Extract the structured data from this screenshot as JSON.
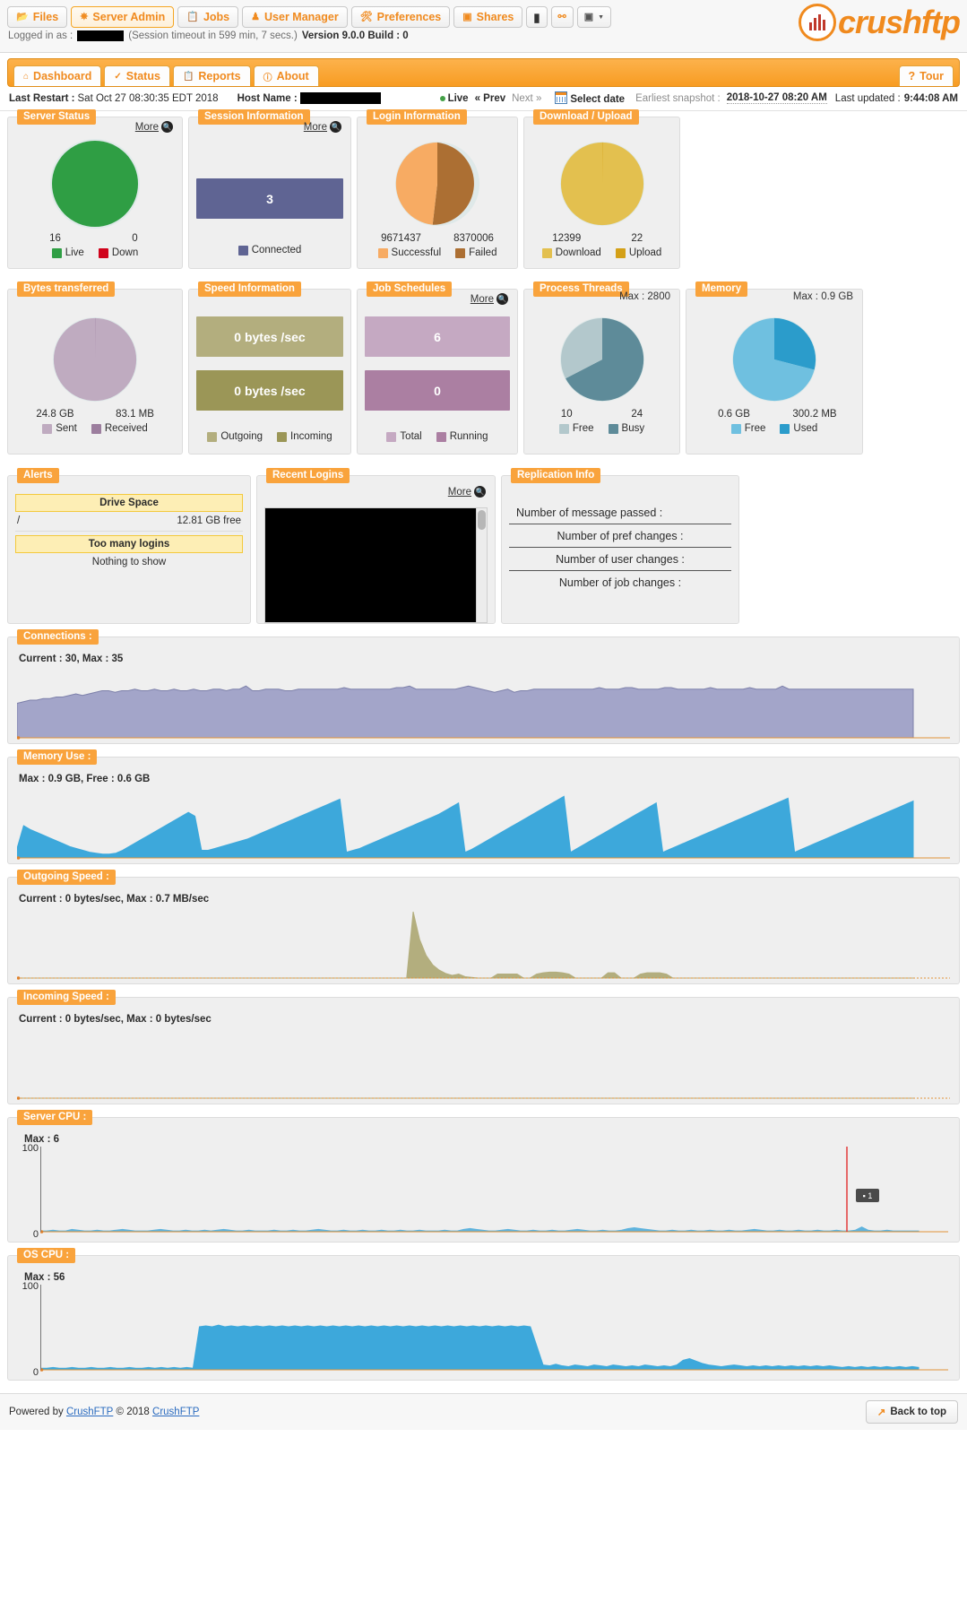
{
  "nav": {
    "items": [
      {
        "label": "Files",
        "icon": "folder-icon",
        "active": false
      },
      {
        "label": "Server Admin",
        "icon": "gear-icon",
        "active": true
      },
      {
        "label": "Jobs",
        "icon": "clipboard-icon",
        "active": false
      },
      {
        "label": "User Manager",
        "icon": "user-icon",
        "active": false
      },
      {
        "label": "Preferences",
        "icon": "sliders-icon",
        "active": false
      },
      {
        "label": "Shares",
        "icon": "share-icon",
        "active": false
      }
    ],
    "icon_buttons": [
      {
        "name": "terminal-icon",
        "glyph": "▮"
      },
      {
        "name": "key-icon",
        "glyph": "⚷"
      },
      {
        "name": "image-dropdown-icon",
        "glyph": "▣"
      }
    ],
    "session": {
      "logged_in_label": "Logged in as :",
      "user_redacted": true,
      "timeout": "(Session timeout in 599 min, 7 secs.)",
      "version": "Version 9.0.0 Build : 0"
    },
    "logo_text_1": "crush",
    "logo_text_2": "ftp"
  },
  "tabs": {
    "items": [
      {
        "label": "Dashboard",
        "icon": "home-icon"
      },
      {
        "label": "Status",
        "icon": "check-icon"
      },
      {
        "label": "Reports",
        "icon": "report-icon"
      },
      {
        "label": "About",
        "icon": "info-icon"
      }
    ],
    "tour_label": "Tour",
    "tour_icon": "question-icon"
  },
  "infobar": {
    "last_restart_label": "Last Restart :",
    "last_restart_value": "Sat Oct 27 08:30:35 EDT 2018",
    "host_name_label": "Host Name :",
    "host_name_redacted": true,
    "live": "Live",
    "prev": "« Prev",
    "next": "Next »",
    "select_date": "Select date",
    "earliest_snapshot_label": "Earliest snapshot :",
    "earliest_snapshot_value": "2018-10-27 08:20 AM",
    "last_updated_label": "Last updated :",
    "last_updated_value": "9:44:08 AM"
  },
  "widgets": {
    "server_status": {
      "title": "Server Status",
      "more": "More",
      "values": [
        "16",
        "0"
      ],
      "legend": [
        {
          "label": "Live",
          "color": "#2f9e44"
        },
        {
          "label": "Down",
          "color": "#d0021b"
        }
      ],
      "pie": [
        {
          "value": 16,
          "color": "#2f9e44"
        },
        {
          "value": 0,
          "color": "#d0021b"
        }
      ]
    },
    "session_information": {
      "title": "Session Information",
      "more": "More",
      "bar_value": "3",
      "bar_color": "#5f6493",
      "legend": [
        {
          "label": "Connected",
          "color": "#5f6493"
        }
      ]
    },
    "login_information": {
      "title": "Login Information",
      "values": [
        "9671437",
        "8370006"
      ],
      "legend": [
        {
          "label": "Successful",
          "color": "#f7ab63"
        },
        {
          "label": "Failed",
          "color": "#ac6f33"
        }
      ],
      "pie": [
        {
          "value": 9671437,
          "color": "#f7ab63"
        },
        {
          "value": 8370006,
          "color": "#ac6f33"
        }
      ]
    },
    "download_upload": {
      "title": "Download / Upload",
      "values": [
        "12399",
        "22"
      ],
      "legend": [
        {
          "label": "Download",
          "color": "#e3c04f"
        },
        {
          "label": "Upload",
          "color": "#d4a017"
        }
      ],
      "pie": [
        {
          "value": 12399,
          "color": "#e3c04f"
        },
        {
          "value": 22,
          "color": "#d4a017"
        }
      ]
    },
    "bytes_transferred": {
      "title": "Bytes transferred",
      "values": [
        "24.8 GB",
        "83.1 MB"
      ],
      "legend": [
        {
          "label": "Sent",
          "color": "#bfabc0"
        },
        {
          "label": "Received",
          "color": "#9c7e9e"
        }
      ],
      "pie": [
        {
          "value": 24800,
          "color": "#bfabc0"
        },
        {
          "value": 83.1,
          "color": "#9c7e9e"
        }
      ]
    },
    "speed_information": {
      "title": "Speed Information",
      "bars": [
        {
          "value": "0 bytes /sec",
          "color": "#b3ae7e"
        },
        {
          "value": "0 bytes /sec",
          "color": "#9b9657"
        }
      ],
      "legend": [
        {
          "label": "Outgoing",
          "color": "#b3ae7e"
        },
        {
          "label": "Incoming",
          "color": "#9b9657"
        }
      ]
    },
    "job_schedules": {
      "title": "Job Schedules",
      "more": "More",
      "bars": [
        {
          "value": "6",
          "color": "#c5a9c2"
        },
        {
          "value": "0",
          "color": "#ab7fa2"
        }
      ],
      "legend": [
        {
          "label": "Total",
          "color": "#c5a9c2"
        },
        {
          "label": "Running",
          "color": "#ab7fa2"
        }
      ]
    },
    "process_threads": {
      "title": "Process Threads",
      "max_label": "Max : 2800",
      "values": [
        "10",
        "24"
      ],
      "legend": [
        {
          "label": "Free",
          "color": "#b3c8cc"
        },
        {
          "label": "Busy",
          "color": "#5e8b99"
        }
      ],
      "pie": [
        {
          "value": 10,
          "color": "#b3c8cc"
        },
        {
          "value": 24,
          "color": "#5e8b99"
        }
      ]
    },
    "memory": {
      "title": "Memory",
      "max_label": "Max : 0.9 GB",
      "values": [
        "0.6 GB",
        "300.2 MB"
      ],
      "legend": [
        {
          "label": "Free",
          "color": "#6fc0e0"
        },
        {
          "label": "Used",
          "color": "#2b9ccb"
        }
      ],
      "pie": [
        {
          "value": 0.6,
          "color": "#6fc0e0"
        },
        {
          "value": 0.3002,
          "color": "#2b9ccb"
        }
      ]
    },
    "alerts": {
      "title": "Alerts",
      "band1": "Drive Space",
      "row1_left": "/",
      "row1_right": "12.81 GB free",
      "band2": "Too many logins",
      "note": "Nothing to show"
    },
    "recent_logins": {
      "title": "Recent Logins",
      "more": "More"
    },
    "replication_info": {
      "title": "Replication Info",
      "rows": [
        "Number of message passed :",
        "Number of pref changes :",
        "Number of user changes :",
        "Number of job changes :"
      ]
    }
  },
  "chart_data": [
    {
      "type": "area",
      "name": "connections",
      "title": "Connections :",
      "subtitle": "Current : 30, Max : 35",
      "current": 30,
      "max": 35,
      "ylim": [
        0,
        35
      ],
      "grid": false,
      "color": "#a3a5c9",
      "line_color": "#7d80aa",
      "values": [
        22,
        23,
        24,
        24,
        25,
        25,
        26,
        26,
        27,
        28,
        27,
        28,
        29,
        30,
        30,
        29,
        30,
        30,
        31,
        30,
        30,
        31,
        30,
        30,
        31,
        30,
        30,
        31,
        30,
        30,
        31,
        31,
        30,
        31,
        31,
        33,
        30,
        30,
        31,
        31,
        31,
        30,
        30,
        31,
        31,
        31,
        31,
        31,
        31,
        31,
        32,
        31,
        31,
        31,
        31,
        31,
        31,
        31,
        32,
        32,
        33,
        31,
        31,
        31,
        31,
        31,
        31,
        31,
        32,
        33,
        32,
        31,
        30,
        29,
        30,
        31,
        29,
        30,
        30,
        31,
        31,
        31,
        31,
        31,
        31,
        31,
        31,
        31,
        31,
        32,
        31,
        31,
        31,
        32,
        32,
        31,
        31,
        31,
        31,
        32,
        32,
        31,
        31,
        31,
        31,
        31,
        32,
        31,
        31,
        31,
        31,
        31,
        32,
        31,
        31,
        31,
        31,
        33,
        31,
        31,
        31,
        31,
        31,
        31,
        31,
        31,
        31,
        31,
        31,
        31,
        31,
        31,
        31,
        31,
        31,
        31,
        31,
        31
      ]
    },
    {
      "type": "area",
      "name": "memory_use",
      "title": "Memory Use :",
      "subtitle": "Max : 0.9 GB, Free : 0.6 GB",
      "max": "0.9 GB",
      "free": "0.6 GB",
      "grid": false,
      "color": "#3da8db",
      "values": [
        10,
        34,
        30,
        27,
        24,
        21,
        18,
        15,
        12,
        10,
        8,
        6,
        5,
        4,
        4,
        5,
        8,
        12,
        16,
        20,
        24,
        28,
        32,
        36,
        40,
        44,
        48,
        44,
        8,
        8,
        10,
        12,
        14,
        16,
        18,
        20,
        23,
        26,
        29,
        32,
        35,
        38,
        41,
        44,
        47,
        50,
        53,
        56,
        59,
        62,
        6,
        8,
        10,
        13,
        16,
        19,
        22,
        25,
        28,
        31,
        34,
        37,
        40,
        43,
        46,
        50,
        54,
        58,
        6,
        9,
        13,
        17,
        21,
        25,
        29,
        33,
        37,
        41,
        45,
        49,
        53,
        57,
        61,
        65,
        6,
        10,
        14,
        18,
        22,
        26,
        30,
        34,
        38,
        42,
        46,
        50,
        54,
        58,
        6,
        9,
        12,
        15,
        18,
        21,
        24,
        27,
        30,
        33,
        36,
        39,
        42,
        45,
        48,
        51,
        54,
        57,
        60,
        63,
        6,
        9,
        12,
        15,
        18,
        21,
        24,
        27,
        30,
        33,
        36,
        39,
        42,
        45,
        48,
        51,
        54,
        57,
        60
      ]
    },
    {
      "type": "area",
      "name": "outgoing_speed",
      "title": "Outgoing Speed :",
      "subtitle": "Current : 0 bytes/sec, Max : 0.7 MB/sec",
      "current": "0 bytes/sec",
      "max": "0.7 MB/sec",
      "grid": false,
      "color": "#b3ae7e",
      "values": [
        0,
        0,
        0,
        0,
        0,
        0,
        0,
        0,
        0,
        0,
        0,
        0,
        0,
        0,
        0,
        0,
        0,
        0,
        0,
        0,
        0,
        0,
        0,
        0,
        0,
        0,
        0,
        0,
        0,
        0,
        0,
        0,
        0,
        0,
        0,
        0,
        0,
        0,
        0,
        0,
        0,
        0,
        0,
        0,
        0,
        0,
        0,
        0,
        0,
        0,
        0,
        0,
        0,
        0,
        0,
        0,
        0,
        0,
        0,
        0,
        0,
        100,
        58,
        34,
        20,
        12,
        7,
        4,
        6,
        2,
        1,
        0,
        0,
        0,
        6,
        6,
        6,
        6,
        0,
        0,
        6,
        8,
        9,
        9,
        8,
        6,
        0,
        0,
        0,
        0,
        0,
        8,
        8,
        0,
        0,
        0,
        6,
        8,
        8,
        8,
        6,
        0,
        0,
        0,
        0,
        0,
        0,
        0,
        0,
        0,
        0,
        0,
        0,
        0,
        0,
        0,
        0,
        0,
        0,
        0,
        0,
        0,
        0,
        0,
        0,
        0,
        0,
        0,
        0,
        0,
        0,
        0,
        0,
        0,
        0,
        0,
        0,
        0,
        0
      ]
    },
    {
      "type": "area",
      "name": "incoming_speed",
      "title": "Incoming Speed :",
      "subtitle": "Current : 0 bytes/sec, Max : 0 bytes/sec",
      "current": "0 bytes/sec",
      "max": "0 bytes/sec",
      "grid": false,
      "color": "#b3ae7e",
      "values": [
        0,
        0,
        0,
        0,
        0,
        0,
        0,
        0,
        0,
        0,
        0,
        0,
        0,
        0,
        0,
        0,
        0,
        0,
        0,
        0,
        0,
        0,
        0,
        0,
        0,
        0,
        0,
        0,
        0,
        0,
        0,
        0,
        0,
        0,
        0,
        0,
        0,
        0,
        0,
        0,
        0,
        0,
        0,
        0,
        0,
        0,
        0,
        0,
        0,
        0,
        0,
        0,
        0,
        0,
        0,
        0,
        0,
        0,
        0,
        0,
        0,
        0,
        0,
        0,
        0,
        0,
        0,
        0,
        0,
        0,
        0,
        0,
        0,
        0,
        0,
        0,
        0,
        0,
        0,
        0,
        0,
        0,
        0,
        0,
        0,
        0,
        0,
        0,
        0,
        0,
        0,
        0,
        0,
        0,
        0,
        0,
        0,
        0,
        0,
        0
      ]
    },
    {
      "type": "area",
      "name": "server_cpu",
      "title": "Server CPU :",
      "subtitle": "Max : 6",
      "max": 6,
      "ylim": [
        0,
        100
      ],
      "yticks": [
        "100",
        "0"
      ],
      "grid": false,
      "color": "#5fb3dd",
      "marker_label": "1",
      "marker_color": "#e23b3b",
      "values": [
        1,
        1,
        2,
        1,
        1,
        3,
        2,
        1,
        1,
        2,
        1,
        1,
        2,
        3,
        2,
        1,
        1,
        1,
        2,
        3,
        2,
        1,
        1,
        2,
        1,
        1,
        2,
        1,
        2,
        3,
        2,
        1,
        1,
        2,
        1,
        1,
        1,
        2,
        1,
        1,
        2,
        1,
        1,
        2,
        3,
        2,
        1,
        1,
        2,
        1,
        1,
        2,
        1,
        1,
        2,
        1,
        1,
        2,
        1,
        1,
        2,
        1,
        1,
        1,
        2,
        1,
        1,
        3,
        4,
        3,
        2,
        1,
        1,
        2,
        3,
        2,
        1,
        1,
        2,
        1,
        1,
        2,
        1,
        1,
        2,
        3,
        2,
        1,
        1,
        2,
        1,
        1,
        2,
        4,
        5,
        4,
        3,
        2,
        1,
        1,
        2,
        1,
        1,
        2,
        1,
        1,
        2,
        1,
        1,
        2,
        1,
        1,
        2,
        3,
        2,
        1,
        1,
        2,
        1,
        1,
        2,
        1,
        1,
        2,
        1,
        1,
        2,
        1,
        1,
        2,
        6,
        2,
        1,
        1,
        2,
        1,
        1,
        1,
        1,
        1
      ]
    },
    {
      "type": "area",
      "name": "os_cpu",
      "title": "OS CPU :",
      "subtitle": "Max : 56",
      "max": 56,
      "ylim": [
        0,
        100
      ],
      "yticks": [
        "100",
        "0"
      ],
      "grid": false,
      "color": "#3da8db",
      "values": [
        2,
        2,
        3,
        2,
        2,
        3,
        2,
        2,
        3,
        2,
        2,
        3,
        2,
        2,
        3,
        2,
        2,
        3,
        2,
        3,
        2,
        3,
        2,
        3,
        2,
        54,
        55,
        54,
        56,
        54,
        55,
        54,
        55,
        54,
        55,
        54,
        55,
        54,
        55,
        54,
        55,
        54,
        55,
        54,
        55,
        54,
        55,
        54,
        55,
        54,
        55,
        54,
        55,
        54,
        55,
        54,
        55,
        54,
        55,
        54,
        55,
        54,
        55,
        54,
        55,
        54,
        55,
        54,
        55,
        54,
        55,
        54,
        55,
        54,
        55,
        54,
        55,
        54,
        30,
        6,
        5,
        7,
        5,
        4,
        6,
        5,
        4,
        6,
        5,
        4,
        6,
        5,
        4,
        5,
        4,
        6,
        5,
        4,
        5,
        4,
        6,
        12,
        14,
        11,
        8,
        6,
        5,
        4,
        5,
        6,
        5,
        4,
        5,
        4,
        5,
        4,
        5,
        4,
        5,
        4,
        5,
        4,
        5,
        4,
        5,
        4,
        3,
        4,
        3,
        4,
        3,
        4,
        3,
        4,
        3,
        4,
        3,
        4,
        3
      ]
    }
  ],
  "footer": {
    "powered_by": "Powered by",
    "link1": "CrushFTP",
    "copyright": "© 2018",
    "link2": "CrushFTP",
    "back_to_top": "Back to top"
  }
}
